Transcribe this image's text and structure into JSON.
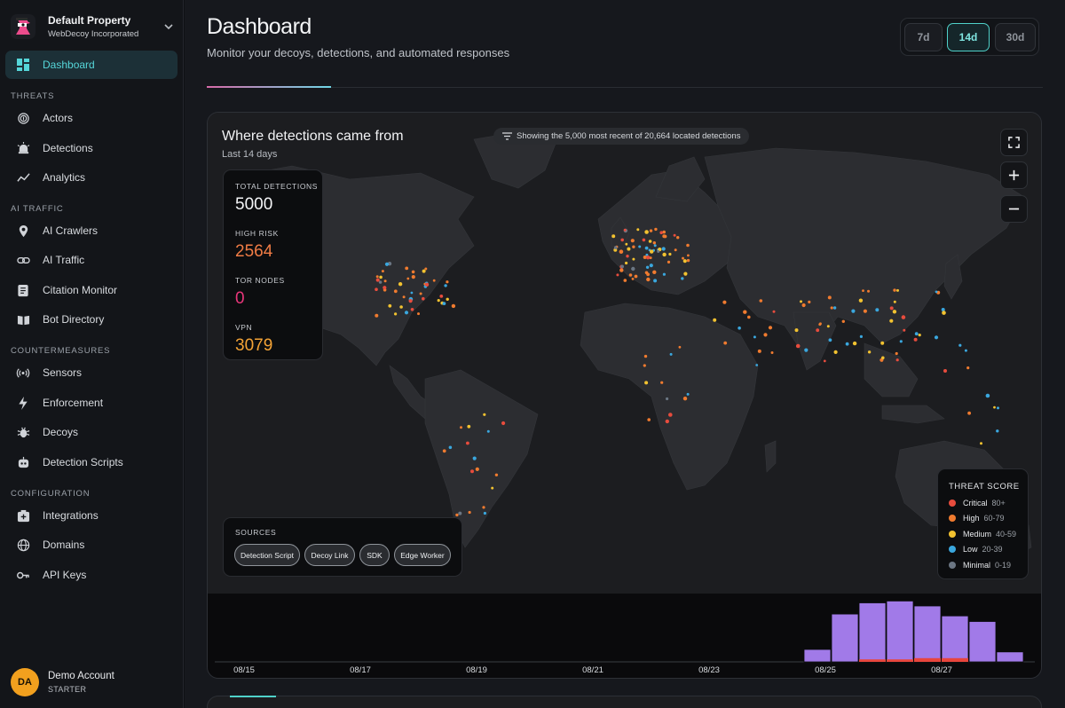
{
  "property": {
    "name": "Default Property",
    "org": "WebDecoy Incorporated"
  },
  "nav": {
    "dashboard": "Dashboard",
    "sections": {
      "threats": "THREATS",
      "ai_traffic": "AI TRAFFIC",
      "countermeasures": "COUNTERMEASURES",
      "configuration": "CONFIGURATION"
    },
    "threats": [
      "Actors",
      "Detections",
      "Analytics"
    ],
    "ai_traffic": [
      "AI Crawlers",
      "AI Traffic",
      "Citation Monitor",
      "Bot Directory"
    ],
    "countermeasures": [
      "Sensors",
      "Enforcement",
      "Decoys",
      "Detection Scripts"
    ],
    "configuration": [
      "Integrations",
      "Domains",
      "API Keys"
    ]
  },
  "account": {
    "initials": "DA",
    "name": "Demo Account",
    "plan": "STARTER"
  },
  "header": {
    "title": "Dashboard",
    "subtitle": "Monitor your decoys, detections, and automated responses",
    "ranges": [
      "7d",
      "14d",
      "30d"
    ],
    "selected_range": "14d"
  },
  "map": {
    "title": "Where detections came from",
    "subtitle": "Last 14 days",
    "notice": "Showing the 5,000 most recent of 20,664 located detections",
    "stats": [
      {
        "label": "TOTAL DETECTIONS",
        "value": "5000",
        "color": "#f4f5f7"
      },
      {
        "label": "HIGH RISK",
        "value": "2564",
        "color": "#f07c45"
      },
      {
        "label": "TOR NODES",
        "value": "0",
        "color": "#e8367a"
      },
      {
        "label": "VPN",
        "value": "3079",
        "color": "#f4a336"
      }
    ],
    "sources": {
      "label": "SOURCES",
      "chips": [
        "Detection Script",
        "Decoy Link",
        "SDK",
        "Edge Worker"
      ]
    },
    "legend": {
      "title": "THREAT SCORE",
      "items": [
        {
          "label": "Critical",
          "range": "80+",
          "color": "#e84c3d"
        },
        {
          "label": "High",
          "range": "60-79",
          "color": "#f07b2f"
        },
        {
          "label": "Medium",
          "range": "40-59",
          "color": "#f2c230"
        },
        {
          "label": "Low",
          "range": "20-39",
          "color": "#3aa7de"
        },
        {
          "label": "Minimal",
          "range": "0-19",
          "color": "#6b7683"
        }
      ]
    }
  },
  "timeline": {
    "labels": [
      "08/15",
      "08/17",
      "08/19",
      "08/21",
      "08/23",
      "08/25",
      "08/27"
    ],
    "bar_color": "#a17ae8",
    "critical_color": "#e8453c",
    "bars": [
      {
        "level": 0.2,
        "critical": 0
      },
      {
        "level": 0.77,
        "critical": 0
      },
      {
        "level": 0.95,
        "critical": 0.04
      },
      {
        "level": 0.98,
        "critical": 0.04
      },
      {
        "level": 0.9,
        "critical": 0.06
      },
      {
        "level": 0.74,
        "critical": 0.06
      },
      {
        "level": 0.65,
        "critical": 0
      },
      {
        "level": 0.16,
        "critical": 0
      }
    ]
  }
}
